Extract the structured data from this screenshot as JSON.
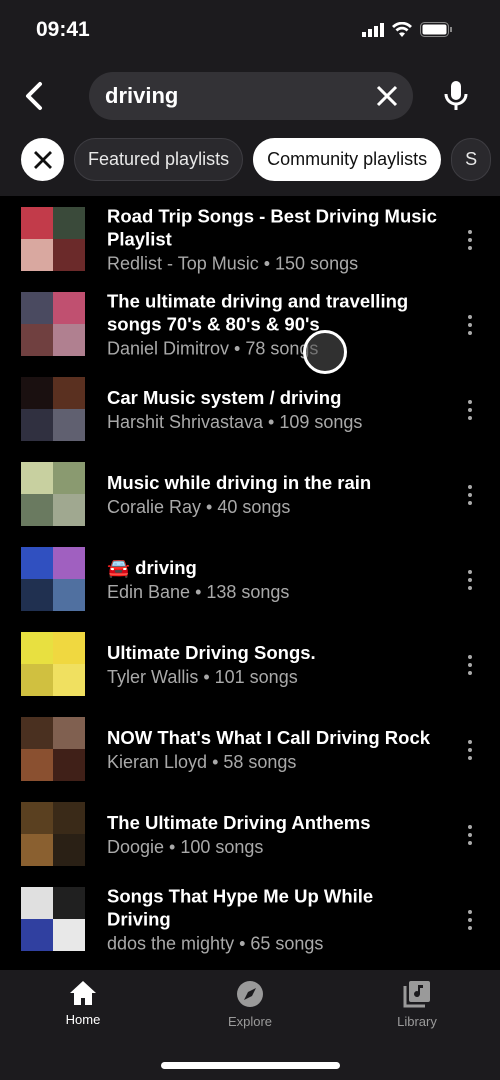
{
  "status_bar": {
    "time": "09:41"
  },
  "search": {
    "query": "driving"
  },
  "chips": [
    "Featured playlists",
    "Community playlists",
    "S"
  ],
  "playlists": [
    {
      "title": "Road Trip Songs - Best Driving Music Playlist",
      "subtitle": "Redlist - Top Music • 150 songs",
      "colors": [
        "#c23b4a",
        "#3a4a3a",
        "#d9a8a0",
        "#6b2a2a"
      ]
    },
    {
      "title": "The ultimate driving and travelling songs 70's & 80's & 90's",
      "subtitle": "Daniel Dimitrov • 78 songs",
      "colors": [
        "#4a4a60",
        "#c05070",
        "#704040",
        "#b08090"
      ]
    },
    {
      "title": "Car Music system / driving",
      "subtitle": "Harshit Shrivastava • 109 songs",
      "colors": [
        "#1a1010",
        "#5a3020",
        "#303040",
        "#606070"
      ]
    },
    {
      "title": "Music while driving in the rain",
      "subtitle": "Coralie Ray • 40 songs",
      "colors": [
        "#c8d0a0",
        "#8a9a70",
        "#6a7a60",
        "#a0a890"
      ]
    },
    {
      "title": "🚘 driving",
      "subtitle": "Edin Bane • 138 songs",
      "colors": [
        "#3050c0",
        "#a060c0",
        "#203050",
        "#5070a0"
      ]
    },
    {
      "title": "Ultimate Driving Songs.",
      "subtitle": "Tyler Wallis • 101 songs",
      "colors": [
        "#e8e040",
        "#f0d840",
        "#d0c040",
        "#f0e060"
      ]
    },
    {
      "title": "NOW That's What I Call Driving Rock",
      "subtitle": "Kieran Lloyd • 58 songs",
      "colors": [
        "#4a3020",
        "#806050",
        "#8a5030",
        "#402018"
      ]
    },
    {
      "title": "The Ultimate Driving Anthems",
      "subtitle": "Doogie • 100 songs",
      "colors": [
        "#5a4020",
        "#3a2a18",
        "#8a6030",
        "#2a2015"
      ]
    },
    {
      "title": "Songs That Hype Me Up While Driving",
      "subtitle": "ddos the mighty • 65 songs",
      "colors": [
        "#e0e0e0",
        "#202020",
        "#3040a0",
        "#e8e8e8"
      ]
    }
  ],
  "nav": [
    {
      "label": "Home",
      "icon": "home-icon",
      "active": true
    },
    {
      "label": "Explore",
      "icon": "compass-icon"
    },
    {
      "label": "Library",
      "icon": "library-icon"
    }
  ]
}
